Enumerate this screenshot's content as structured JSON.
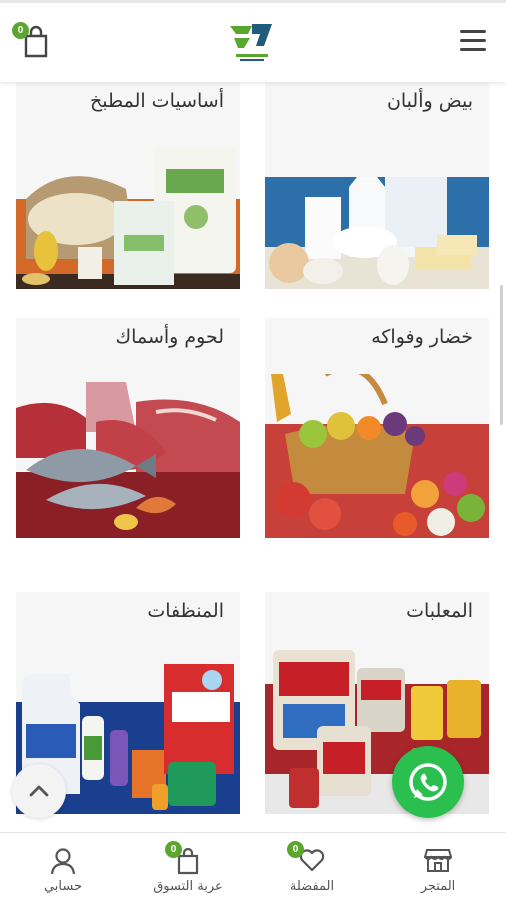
{
  "header": {
    "cart_count": "0",
    "logo_icon": "brand-logo"
  },
  "categories": [
    {
      "title": "بيض وألبان",
      "image": "dairy-eggs-photo"
    },
    {
      "title": "أساسيات المطبخ",
      "image": "kitchen-staples-photo"
    },
    {
      "title": "خضار وفواكه",
      "image": "fruits-vegetables-photo"
    },
    {
      "title": "لحوم وأسماك",
      "image": "meat-fish-photo"
    },
    {
      "title": "المعلبات",
      "image": "canned-goods-photo"
    },
    {
      "title": "المنظفات",
      "image": "cleaning-products-photo"
    }
  ],
  "bottom_nav": {
    "store": {
      "label": "المتجر",
      "icon": "store-icon"
    },
    "favorites": {
      "label": "المفضلة",
      "icon": "heart-icon",
      "count": "0"
    },
    "cart": {
      "label": "عربة التسوق",
      "icon": "shopping-bag-icon",
      "count": "0"
    },
    "account": {
      "label": "حسابي",
      "icon": "user-icon"
    }
  },
  "colors": {
    "accent_green": "#5aa62f",
    "whatsapp_green": "#2bbf4f"
  }
}
